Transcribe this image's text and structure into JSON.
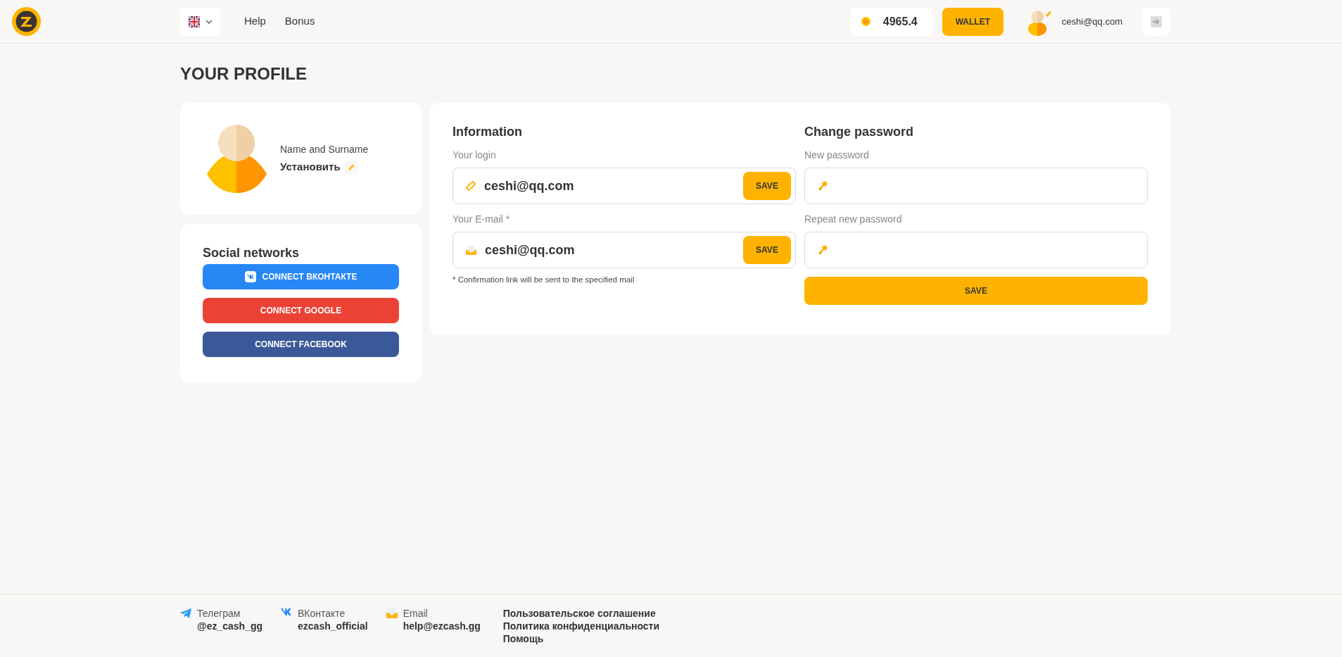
{
  "header": {
    "nav": [
      "Help",
      "Bonus"
    ],
    "balance": "4965.4",
    "wallet_button": "WALLET",
    "user_email": "ceshi@qq.com"
  },
  "page_title": "YOUR PROFILE",
  "name_card": {
    "label": "Name and Surname",
    "value": "Установить"
  },
  "social": {
    "title": "Social networks",
    "buttons": [
      {
        "kind": "vk",
        "label": "CONNECT ВКОНТАКТЕ"
      },
      {
        "kind": "google",
        "label": "CONNECT GOOGLE"
      },
      {
        "kind": "facebook",
        "label": "CONNECT FACEBOOK"
      }
    ]
  },
  "information": {
    "title": "Information",
    "fields": [
      {
        "kind": "login",
        "label": "Your login",
        "value": "ceshi@qq.com",
        "button": "SAVE"
      },
      {
        "kind": "email",
        "label": "Your E-mail *",
        "value": "ceshi@qq.com",
        "button": "SAVE"
      }
    ],
    "note": "* Confirmation link will be sent to the specified mail"
  },
  "password": {
    "title": "Change password",
    "fields": [
      {
        "label": "New password"
      },
      {
        "label": "Repeat new password"
      }
    ],
    "button": "SAVE"
  },
  "footer": {
    "contacts": [
      {
        "kind": "telegram",
        "label": "Телеграм",
        "value": "@ez_cash_gg"
      },
      {
        "kind": "vk",
        "label": "ВКонтакте",
        "value": "ezcash_official"
      },
      {
        "kind": "email",
        "label": "Email",
        "value": "help@ezcash.gg"
      }
    ],
    "links": [
      "Пользовательское соглашение",
      "Политика конфиденциальности",
      "Помощь"
    ]
  }
}
